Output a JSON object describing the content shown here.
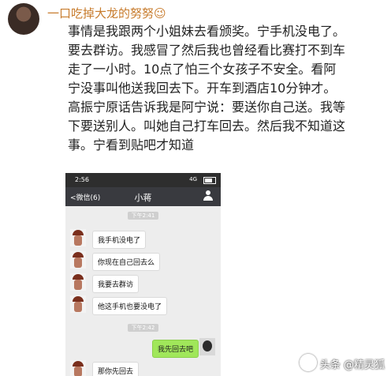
{
  "post": {
    "username": "一口吃掉大龙的努努😉",
    "lines": [
      "事情是我跟两个小姐妹去看颁奖。宁手机没电了。",
      "要去群访。我感冒了然后我也曾经看比赛打不到车",
      "走了一小时。10点了怕三个女孩子不安全。看阿",
      "宁没事叫他送我回去下。开车到酒店10分钟才。",
      "高振宁原话告诉我是阿宁说：要送你自己送。我等",
      "下要送别人。叫她自己打车回去。然后我不知道这",
      "事。宁看到贴吧才知道"
    ]
  },
  "phone": {
    "status_time": "2:56",
    "status_signal": "4G",
    "back_label": "<微信(6)",
    "chat_title": "小蒋",
    "timestamps": [
      "下午2:41",
      "下午2:42"
    ],
    "messages": [
      "我手机没电了",
      "你现在自己回去么",
      "我要去群访",
      "他这手机也要没电了"
    ],
    "outgoing": "我先回去吧",
    "last_message": "那你先回去"
  },
  "watermark": "头条 @精灵狐"
}
